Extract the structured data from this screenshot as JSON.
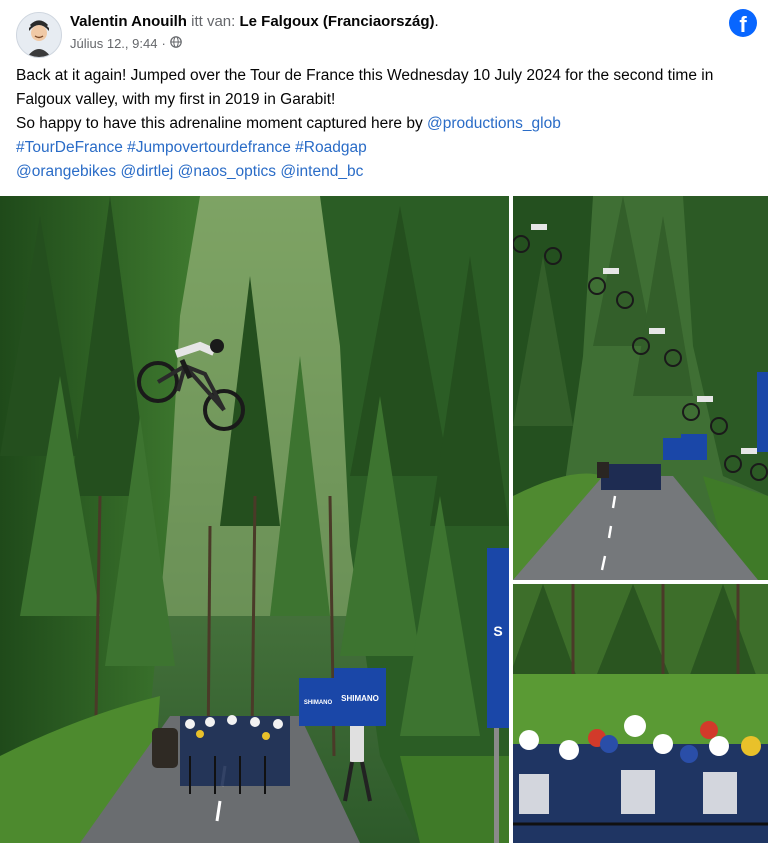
{
  "post": {
    "author": "Valentin Anouilh",
    "location_prefix": "itt van:",
    "location": "Le Falgoux (Franciaország)",
    "location_suffix": ".",
    "timestamp": "Július 12., 9:44",
    "separator": "·",
    "privacy_icon": "globe-icon",
    "text_line1": "Back at it again! Jumped over the Tour de France this Wednesday 10 July 2024 for the second time in Falgoux valley, with my first in 2019 in Garabit!",
    "text_line2_prefix": "So happy to have this adrenaline moment captured here by ",
    "text_line2_mention": "@productions_glob",
    "hashtags": [
      "#TourDeFrance",
      "#Jumpovertourdefrance",
      "#Roadgap"
    ],
    "mentions": [
      "@orangebikes",
      "@dirtlej",
      "@naos_optics",
      "@intend_bc"
    ]
  },
  "brand": {
    "icon": "facebook-icon",
    "logo_letter": "f",
    "color": "#0866ff"
  },
  "photos": {
    "banner_text": "SHIMANO",
    "banner_letter": "S"
  },
  "colors": {
    "link": "#2a6cc7",
    "muted": "#65676b",
    "text": "#050505"
  }
}
